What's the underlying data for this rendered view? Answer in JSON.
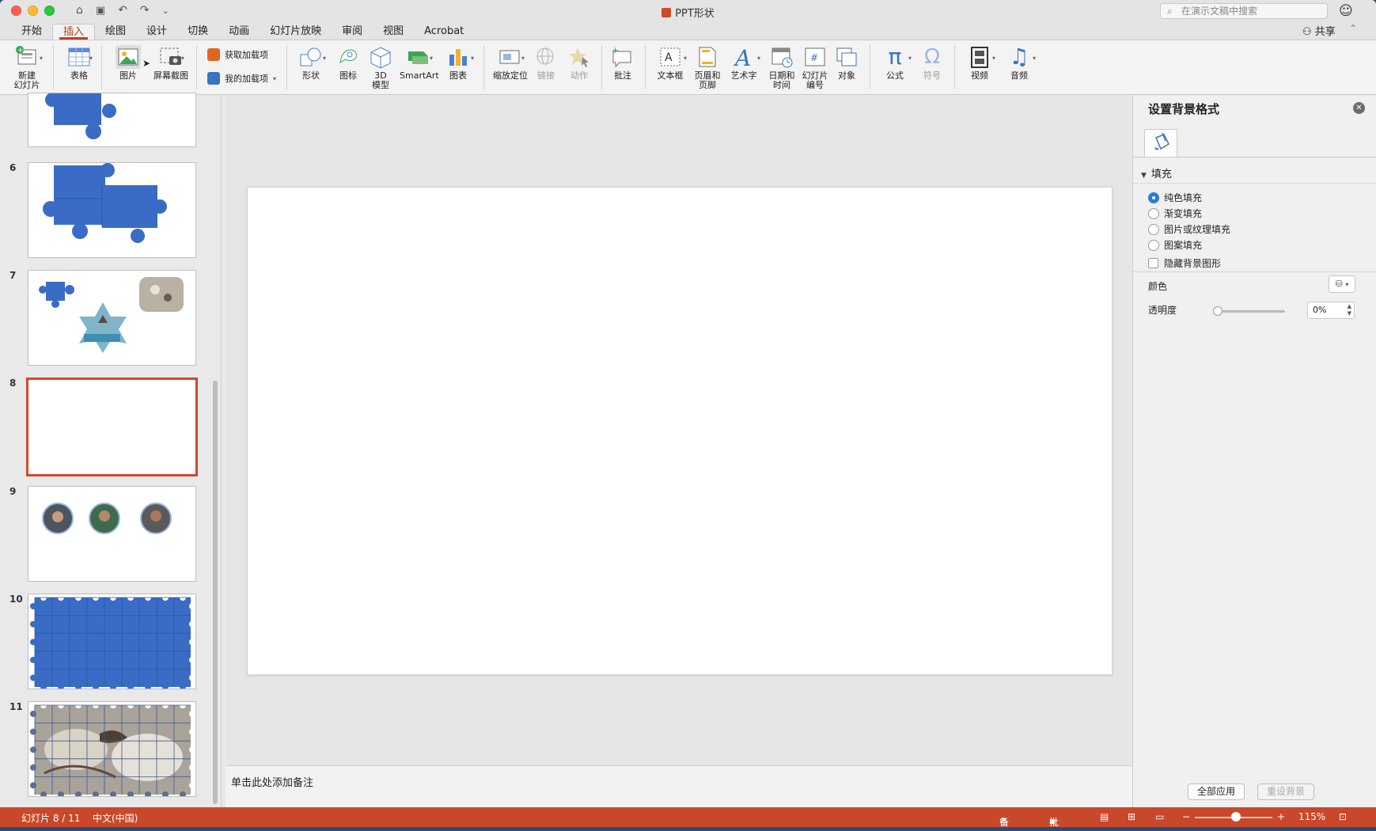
{
  "window": {
    "title": "PPT形状",
    "search_placeholder": "在演示文稿中搜索",
    "share_label": "共享",
    "smiley": "☺"
  },
  "qat": {
    "home_icon": "⌂",
    "save_icon": "🖫",
    "undo_icon": "↶",
    "redo_icon": "↷",
    "more_icon": "⌄"
  },
  "tabs": [
    "开始",
    "插入",
    "绘图",
    "设计",
    "切换",
    "动画",
    "幻灯片放映",
    "审阅",
    "视图",
    "Acrobat"
  ],
  "active_tab": "插入",
  "ribbon": {
    "new_slide": "新建\n幻灯片",
    "table": "表格",
    "picture": "图片",
    "screenshot": "屏幕截图",
    "get_addins": "获取加载项",
    "my_addins": "我的加载项",
    "shapes": "形状",
    "icons": "图标",
    "model3d": "3D\n模型",
    "smartart": "SmartArt",
    "chart": "图表",
    "zoom": "缩放定位",
    "link": "链接",
    "action": "动作",
    "comment": "批注",
    "textbox": "文本框",
    "header_footer": "页眉和\n页脚",
    "wordart": "艺术字",
    "datetime": "日期和\n时间",
    "slide_number": "幻灯片\n编号",
    "object": "对象",
    "equation": "公式",
    "symbol": "符号",
    "video": "视频",
    "audio": "音频"
  },
  "slides": [
    {
      "num": "",
      "kind": "puzzle-partial"
    },
    {
      "num": "6",
      "kind": "puzzle-three"
    },
    {
      "num": "7",
      "kind": "shapes-photos"
    },
    {
      "num": "8",
      "kind": "blank",
      "selected": true
    },
    {
      "num": "9",
      "kind": "avatars"
    },
    {
      "num": "10",
      "kind": "puzzle-grid"
    },
    {
      "num": "11",
      "kind": "puzzle-photo"
    }
  ],
  "notes_placeholder": "单击此处添加备注",
  "format_pane": {
    "title": "设置背景格式",
    "section": "填充",
    "options": [
      "纯色填充",
      "渐变填充",
      "图片或纹理填充",
      "图案填充"
    ],
    "selected_option": "纯色填充",
    "hide_bg_graphics": "隐藏背景图形",
    "color_label": "颜色",
    "transparency_label": "透明度",
    "transparency_value": "0%",
    "apply_all": "全部应用",
    "reset_bg": "重设背景"
  },
  "status": {
    "slide_info": "幻灯片 8 / 11",
    "language": "中文(中国)",
    "notes": "备注",
    "comments": "批注",
    "zoom": "115%"
  },
  "colors": {
    "accent": "#c43e1c",
    "status_bar": "#c9482a",
    "puzzle_blue": "#3a6cc5"
  }
}
